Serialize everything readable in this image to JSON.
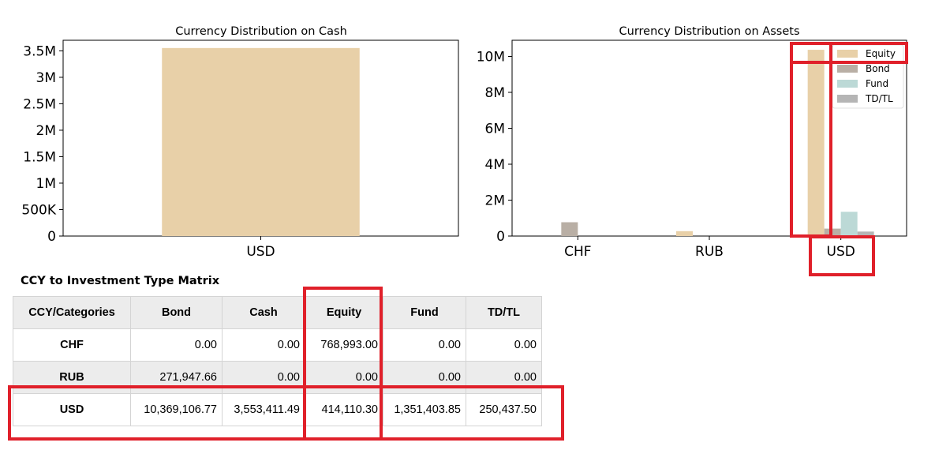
{
  "chart_data": [
    {
      "type": "bar",
      "title": "Currency Distribution on Cash",
      "categories": [
        "USD"
      ],
      "values": [
        3553411.49
      ],
      "ylim": [
        0,
        3700000
      ],
      "yticks": [
        0,
        500000,
        1000000,
        1500000,
        2000000,
        2500000,
        3000000,
        3500000
      ],
      "ytick_labels": [
        "0",
        "500K",
        "1M",
        "1.5M",
        "2M",
        "2.5M",
        "3M",
        "3.5M"
      ],
      "color": "#e8d0a8",
      "grid": false
    },
    {
      "type": "bar",
      "title": "Currency Distribution on Assets",
      "categories": [
        "CHF",
        "RUB",
        "USD"
      ],
      "series": [
        {
          "name": "Equity",
          "color": "#e8d0a8",
          "values": [
            0,
            271947.66,
            10369106.77
          ]
        },
        {
          "name": "Bond",
          "color": "#b9afa5",
          "values": [
            768993.0,
            0,
            414110.3
          ]
        },
        {
          "name": "Fund",
          "color": "#bcd9d6",
          "values": [
            0,
            0,
            1351403.85
          ]
        },
        {
          "name": "TD/TL",
          "color": "#b5b5b5",
          "values": [
            0,
            0,
            250437.5
          ]
        }
      ],
      "ylim": [
        0,
        10900000
      ],
      "yticks": [
        0,
        2000000,
        4000000,
        6000000,
        8000000,
        10000000
      ],
      "ytick_labels": [
        "0",
        "2M",
        "4M",
        "6M",
        "8M",
        "10M"
      ],
      "legend": "top-right",
      "grid": false
    }
  ],
  "matrix": {
    "title": "CCY to Investment Type Matrix",
    "headers": [
      "CCY/Categories",
      "Bond",
      "Cash",
      "Equity",
      "Fund",
      "TD/TL"
    ],
    "rows": [
      {
        "ccy": "CHF",
        "cells": [
          "0.00",
          "0.00",
          "768,993.00",
          "0.00",
          "0.00"
        ]
      },
      {
        "ccy": "RUB",
        "cells": [
          "271,947.66",
          "0.00",
          "0.00",
          "0.00",
          "0.00"
        ]
      },
      {
        "ccy": "USD",
        "cells": [
          "10,369,106.77",
          "3,553,411.49",
          "414,110.30",
          "1,351,403.85",
          "250,437.50"
        ]
      }
    ]
  },
  "highlight_color": "#e0202a"
}
